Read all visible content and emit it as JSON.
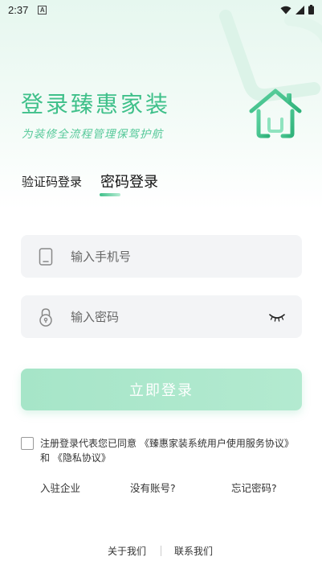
{
  "status_bar": {
    "time": "2:37",
    "notification_badge": "A",
    "icons": [
      "wifi-icon",
      "signal-icon",
      "battery-icon"
    ]
  },
  "header": {
    "title": "登录臻惠家装",
    "subtitle": "为装修全流程管理保驾护航",
    "logo_icon": "house-logo-icon"
  },
  "tabs": {
    "code_login": "验证码登录",
    "password_login": "密码登录",
    "active": "password_login"
  },
  "form": {
    "phone": {
      "placeholder": "输入手机号",
      "value": "",
      "icon": "phone-icon"
    },
    "password": {
      "placeholder": "输入密码",
      "value": "",
      "icon": "lock-icon",
      "toggle_icon": "eye-closed-icon"
    },
    "login_button": "立即登录"
  },
  "agreement": {
    "checked": false,
    "prefix": "注册登录代表您已同意",
    "user_agreement": "《臻惠家装系统用户使用服务协议》",
    "conjunction": " 和 ",
    "privacy_agreement": "《隐私协议》"
  },
  "links": {
    "enter_company": "入驻企业",
    "no_account": "没有账号?",
    "forgot_password": "忘记密码?"
  },
  "footer": {
    "about": "关于我们",
    "contact": "联系我们"
  },
  "colors": {
    "accent": "#3fc08a",
    "button": "#a9e6ca",
    "field_bg": "#f3f4f6"
  }
}
